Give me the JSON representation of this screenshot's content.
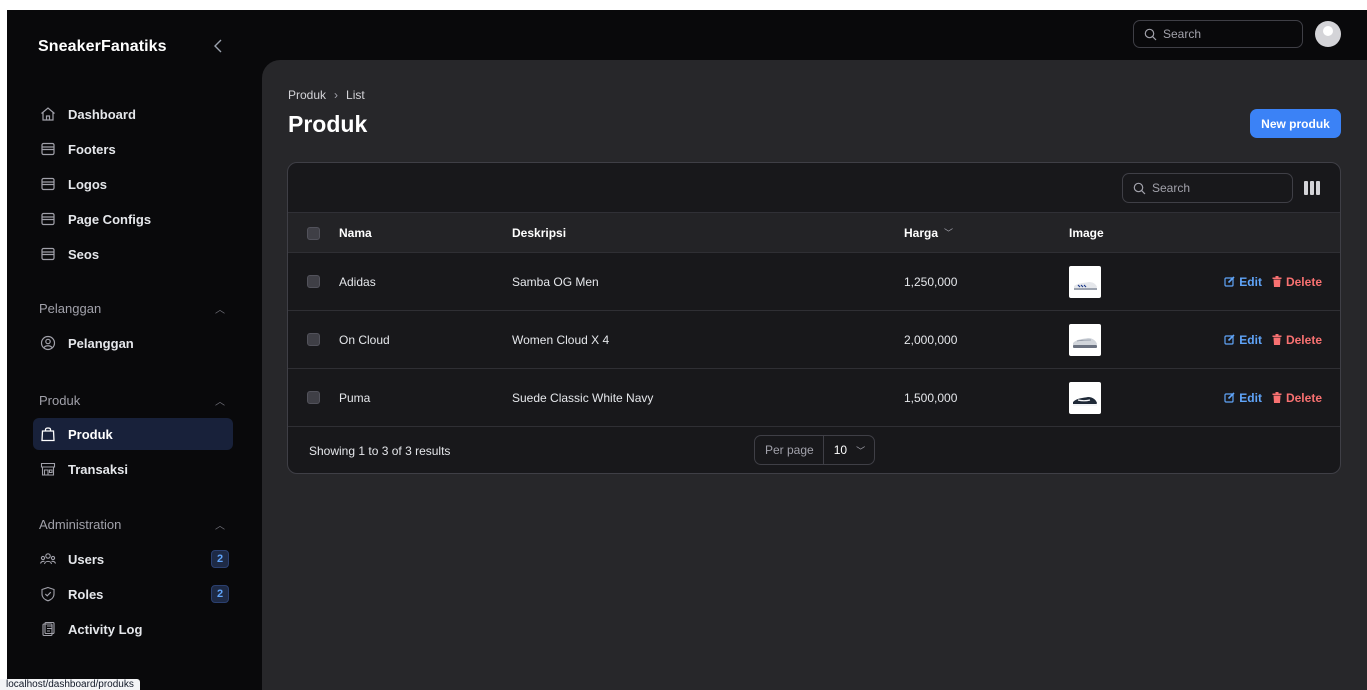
{
  "app": {
    "brand": "SneakerFanatiks",
    "collapse_icon": "chevron-left-icon"
  },
  "sidebar": {
    "items": [
      {
        "label": "Dashboard",
        "icon": "home-icon"
      },
      {
        "label": "Footers",
        "icon": "archive-icon"
      },
      {
        "label": "Logos",
        "icon": "archive-icon"
      },
      {
        "label": "Page Configs",
        "icon": "archive-icon"
      },
      {
        "label": "Seos",
        "icon": "archive-icon"
      }
    ],
    "groups": [
      {
        "label": "Pelanggan",
        "items": [
          {
            "label": "Pelanggan",
            "icon": "user-circle-icon"
          }
        ]
      },
      {
        "label": "Produk",
        "items": [
          {
            "label": "Produk",
            "icon": "shopping-bag-icon",
            "active": true
          },
          {
            "label": "Transaksi",
            "icon": "storefront-icon"
          }
        ]
      },
      {
        "label": "Administration",
        "items": [
          {
            "label": "Users",
            "icon": "users-icon",
            "badge": "2"
          },
          {
            "label": "Roles",
            "icon": "shield-check-icon",
            "badge": "2"
          },
          {
            "label": "Activity Log",
            "icon": "clipboard-icon"
          }
        ]
      }
    ]
  },
  "topbar": {
    "search_placeholder": "Search"
  },
  "main": {
    "breadcrumb": [
      "Produk",
      "List"
    ],
    "title": "Produk",
    "new_button": "New produk"
  },
  "table": {
    "search_placeholder": "Search",
    "columns": {
      "nama": "Nama",
      "deskripsi": "Deskripsi",
      "harga": "Harga",
      "image": "Image"
    },
    "rows": [
      {
        "nama": "Adidas",
        "deskripsi": "Samba OG Men",
        "harga": "1,250,000"
      },
      {
        "nama": "On Cloud",
        "deskripsi": "Women Cloud X 4",
        "harga": "2,000,000"
      },
      {
        "nama": "Puma",
        "deskripsi": "Suede Classic White Navy",
        "harga": "1,500,000"
      }
    ],
    "edit_label": "Edit",
    "delete_label": "Delete",
    "showing": "Showing 1 to 3 of 3 results",
    "per_page_label": "Per page",
    "per_page_value": "10"
  },
  "status_url": "localhost/dashboard/produks",
  "colors": {
    "accent": "#3b82f6",
    "danger": "#f87171",
    "background": "#09090b",
    "content": "#27272a"
  }
}
